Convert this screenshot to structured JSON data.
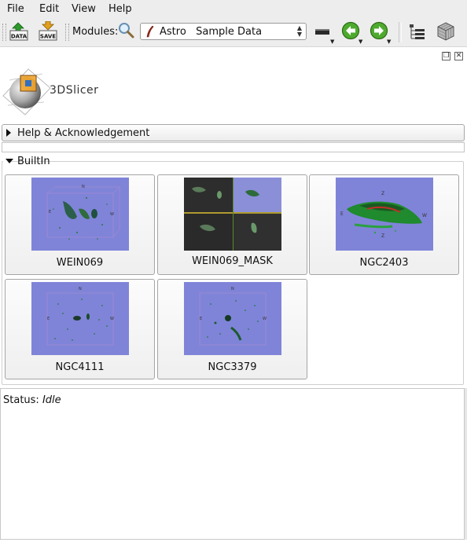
{
  "menu": [
    {
      "label": "File"
    },
    {
      "label": "Edit"
    },
    {
      "label": "View"
    },
    {
      "label": "Help"
    }
  ],
  "toolbar": {
    "data_label": "DATA",
    "save_label": "SAVE",
    "modules_label": "Modules:",
    "module_value": "Astro   Sample Data"
  },
  "app": {
    "logo_text": "3DSlicer"
  },
  "help_section": {
    "label": "Help & Acknowledgement"
  },
  "builtin": {
    "label": "BuiltIn",
    "samples": [
      {
        "name": "WEIN069"
      },
      {
        "name": "WEIN069_MASK"
      },
      {
        "name": "NGC2403"
      },
      {
        "name": "NGC4111"
      },
      {
        "name": "NGC3379"
      }
    ]
  },
  "status": {
    "label": "Status:",
    "value": "Idle"
  },
  "colors": {
    "thumb_bg": "#7f84d8",
    "volume_green": "#2e8b3e",
    "toolbar_bg": "#ededed"
  }
}
